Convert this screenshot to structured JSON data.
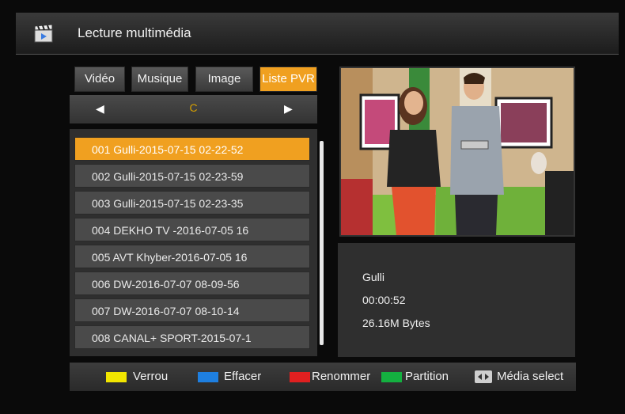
{
  "header": {
    "title": "Lecture multimédia",
    "icon": "clapperboard-icon"
  },
  "tabs": [
    {
      "label": "Vidéo"
    },
    {
      "label": "Musique"
    },
    {
      "label": "Image"
    },
    {
      "label": "Liste PVR",
      "active": true
    }
  ],
  "selector": {
    "value": "C",
    "left_icon": "triangle-left-icon",
    "right_icon": "triangle-right-icon"
  },
  "recordings": [
    {
      "label": "001 Gulli-2015-07-15 02-22-52",
      "selected": true
    },
    {
      "label": "002 Gulli-2015-07-15 02-23-59"
    },
    {
      "label": "003 Gulli-2015-07-15 02-23-35"
    },
    {
      "label": "004 DEKHO TV -2016-07-05 16"
    },
    {
      "label": "005 AVT Khyber-2016-07-05 16"
    },
    {
      "label": "006 DW-2016-07-07 08-09-56"
    },
    {
      "label": "007 DW-2016-07-07 08-10-14"
    },
    {
      "label": "008 CANAL+ SPORT-2015-07-1"
    }
  ],
  "info": {
    "channel": "Gulli",
    "duration": "00:00:52",
    "size": "26.16M Bytes"
  },
  "footer": {
    "keys": [
      {
        "label": "Verrou",
        "color": "#f2e600"
      },
      {
        "label": "Effacer",
        "color": "#1e7fe0"
      },
      {
        "label": "Renommer",
        "color": "#e02020"
      },
      {
        "label": "Partition",
        "color": "#14b040"
      },
      {
        "label": "Média select",
        "icon": "left-right-key-icon"
      }
    ]
  },
  "colors": {
    "accent": "#f0a020",
    "panel": "#2f2f2f",
    "row": "#4a4a4a"
  }
}
